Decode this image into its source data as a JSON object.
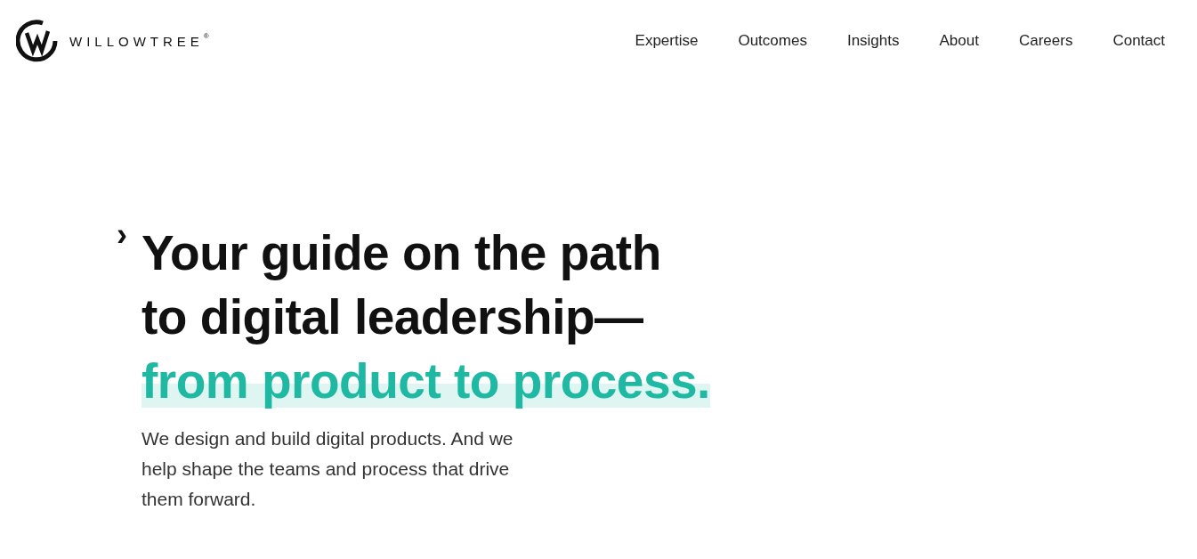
{
  "logo": {
    "wordmark": "WILLOWTREE",
    "registered": "®"
  },
  "nav": {
    "items": [
      "Expertise",
      "Outcomes",
      "Insights",
      "About",
      "Careers",
      "Contact"
    ]
  },
  "hero": {
    "marker": "›",
    "heading_lines": [
      "Your guide on the path",
      "to digital leadership—"
    ],
    "highlight": "from product to process.",
    "body": "We design and build digital products. And we help shape the teams and process that drive them forward."
  }
}
